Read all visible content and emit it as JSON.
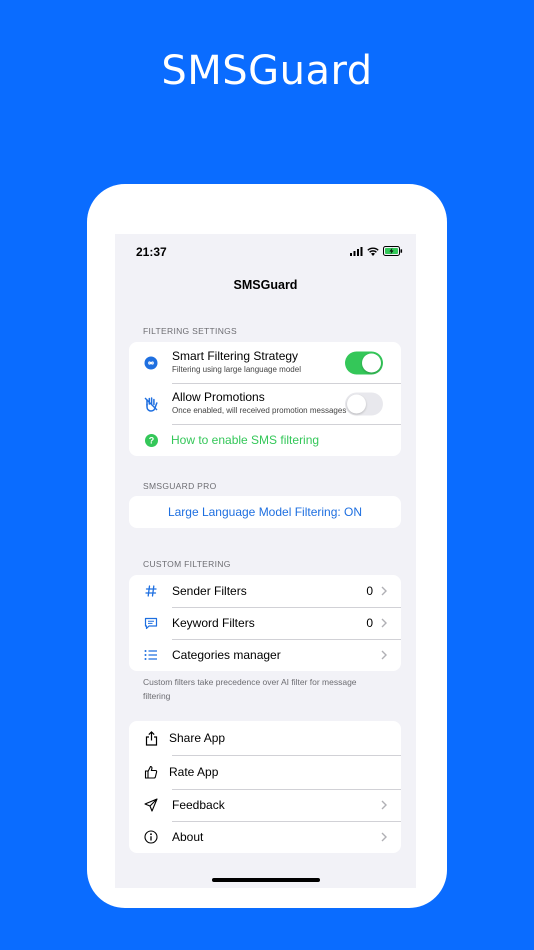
{
  "hero": {
    "title": "SMSGuard"
  },
  "status_bar": {
    "time": "21:37"
  },
  "nav": {
    "title": "SMSGuard"
  },
  "filtering_settings": {
    "header": "FILTERING SETTINGS",
    "smart_filtering": {
      "label": "Smart Filtering Strategy",
      "sublabel": "Filtering using large language model",
      "enabled": true
    },
    "allow_promotions": {
      "label": "Allow Promotions",
      "sublabel": "Once enabled, will received promotion messages",
      "enabled": false
    },
    "help_link": {
      "label": "How to enable SMS filtering"
    }
  },
  "pro": {
    "header": "SMSGUARD PRO",
    "button_label": "Large Language Model Filtering: ON"
  },
  "custom_filtering": {
    "header": "CUSTOM FILTERING",
    "items": [
      {
        "label": "Sender Filters",
        "value": "0"
      },
      {
        "label": "Keyword Filters",
        "value": "0"
      },
      {
        "label": "Categories manager",
        "value": ""
      }
    ],
    "footnote": "Custom filters take precedence over AI filter for message filtering"
  },
  "misc": {
    "items": [
      {
        "label": "Share App"
      },
      {
        "label": "Rate App"
      },
      {
        "label": "Feedback"
      },
      {
        "label": "About"
      }
    ]
  },
  "colors": {
    "background": "#0A6CFF",
    "accent_blue": "#1E6FE0",
    "toggle_green": "#34C759"
  }
}
